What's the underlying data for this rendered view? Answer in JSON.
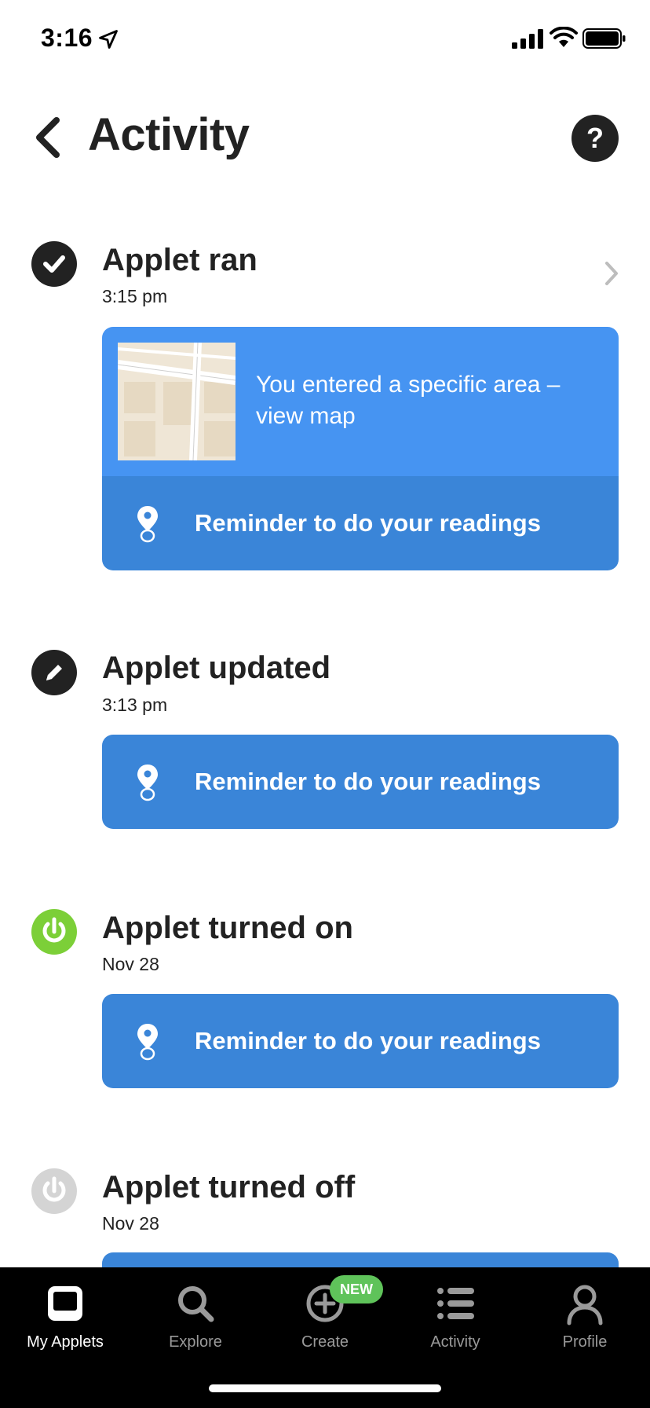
{
  "status_bar": {
    "time": "3:16"
  },
  "header": {
    "title": "Activity",
    "help_label": "?"
  },
  "entries": [
    {
      "title": "Applet ran",
      "time": "3:15 pm",
      "icon": "check-icon",
      "trigger_text": "You entered a specific area – view map",
      "action_label": "Reminder to do your readings"
    },
    {
      "title": "Applet updated",
      "time": "3:13 pm",
      "icon": "pencil-icon",
      "action_label": "Reminder to do your readings"
    },
    {
      "title": "Applet turned on",
      "time": "Nov 28",
      "icon": "power-on-icon",
      "action_label": "Reminder to do your readings"
    },
    {
      "title": "Applet turned off",
      "time": "Nov 28",
      "icon": "power-off-icon"
    }
  ],
  "tab_bar": {
    "tabs": [
      {
        "label": "My Applets",
        "icon": "my-applets-icon",
        "active": true
      },
      {
        "label": "Explore",
        "icon": "search-icon",
        "active": false
      },
      {
        "label": "Create",
        "icon": "plus-circle-icon",
        "active": false
      },
      {
        "label": "Activity",
        "icon": "list-icon",
        "active": false
      },
      {
        "label": "Profile",
        "icon": "person-icon",
        "active": false
      }
    ],
    "badge": "NEW"
  },
  "colors": {
    "card_blue": "#4694f2",
    "action_blue": "#3a85d8",
    "power_on_green": "#7ccf38",
    "power_off_gray": "#d4d4d4",
    "badge_green": "#5fc35a"
  }
}
